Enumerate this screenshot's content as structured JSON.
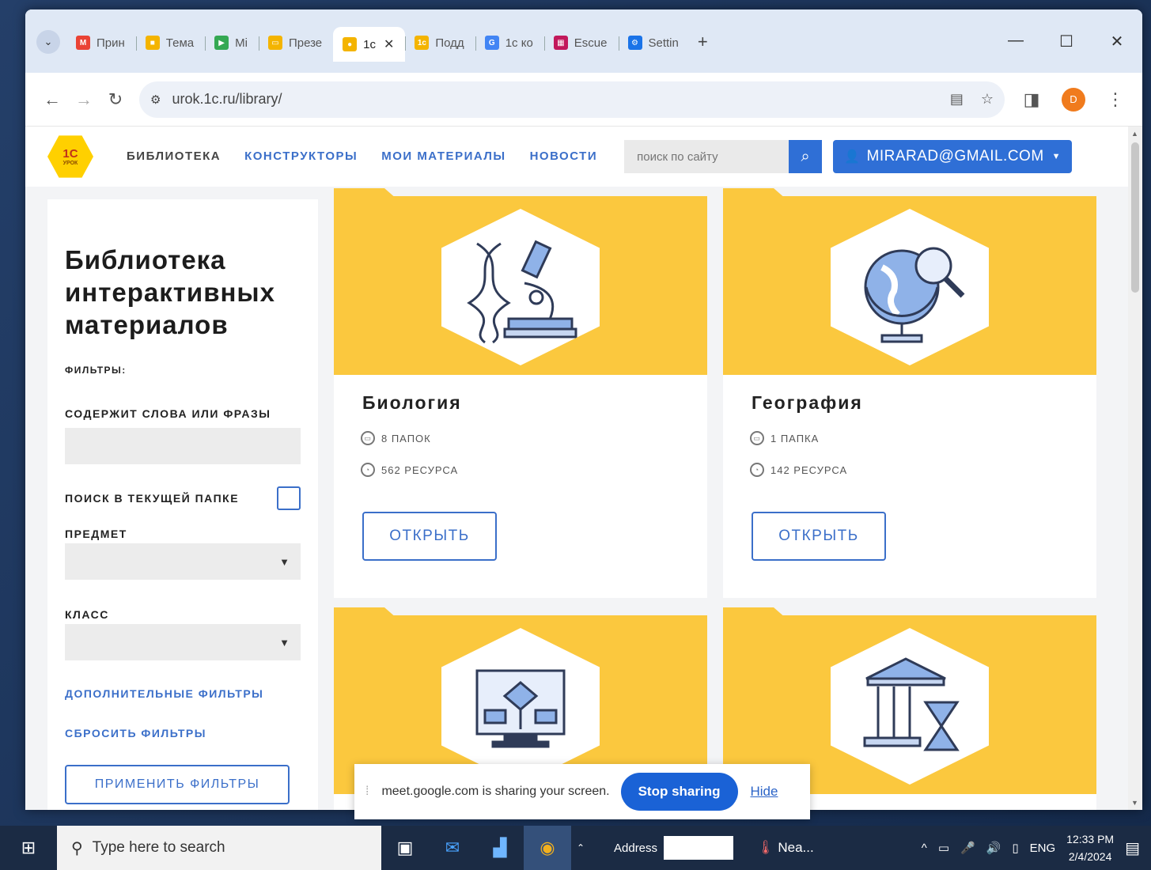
{
  "browser": {
    "tabs": [
      {
        "label": "Прин",
        "color": "#ea4335",
        "glyph": "M"
      },
      {
        "label": "Тема",
        "color": "#f4b400",
        "glyph": "■"
      },
      {
        "label": "Mi",
        "color": "#34a853",
        "glyph": "▶"
      },
      {
        "label": "Презе",
        "color": "#f4b400",
        "glyph": "▭"
      },
      {
        "label": "1с",
        "color": "#f4b400",
        "glyph": "●",
        "active": true
      },
      {
        "label": "Подд",
        "color": "#f4b400",
        "glyph": "1c"
      },
      {
        "label": "1с ко",
        "color": "#4285f4",
        "glyph": "G"
      },
      {
        "label": "Escue",
        "color": "#c2185b",
        "glyph": "▦"
      },
      {
        "label": "Settin",
        "color": "#1a73e8",
        "glyph": "⚙"
      }
    ],
    "new_tab": "+",
    "window_controls": {
      "minimize": "—",
      "maximize": "☐",
      "close": "✕"
    },
    "url": "urok.1c.ru/library/",
    "profile_initial": "D"
  },
  "site": {
    "logo_text": "1С",
    "logo_sub": "УРОК",
    "nav": [
      "БИБЛИОТЕКА",
      "КОНСТРУКТОРЫ",
      "МОИ МАТЕРИАЛЫ",
      "НОВОСТИ"
    ],
    "search_placeholder": "поиск по сайту",
    "user": "MIRARAD@GMAIL.COM"
  },
  "sidebar": {
    "title": "Библиотека интерактивных материалов",
    "filters_label": "ФИЛЬТРЫ:",
    "words_label": "СОДЕРЖИТ СЛОВА ИЛИ ФРАЗЫ",
    "current_folder_label": "ПОИСК В ТЕКУЩЕЙ ПАПКЕ",
    "subject_label": "ПРЕДМЕТ",
    "class_label": "КЛАСС",
    "more_filters": "ДОПОЛНИТЕЛЬНЫЕ ФИЛЬТРЫ",
    "reset_filters": "СБРОСИТЬ ФИЛЬТРЫ",
    "apply_filters": "ПРИМЕНИТЬ ФИЛЬТРЫ"
  },
  "cards": [
    {
      "title": "Биология",
      "folders": "8 ПАПОК",
      "resources": "562 РЕСУРСА",
      "open": "ОТКРЫТЬ"
    },
    {
      "title": "География",
      "folders": "1 ПАПКА",
      "resources": "142 РЕСУРСА",
      "open": "ОТКРЫТЬ"
    }
  ],
  "sharebar": {
    "message": "meet.google.com is sharing your screen.",
    "stop": "Stop sharing",
    "hide": "Hide"
  },
  "taskbar": {
    "search_placeholder": "Type here to search",
    "address_label": "Address",
    "weather": "Nea...",
    "language": "ENG",
    "time": "12:33 PM",
    "date": "2/4/2024"
  }
}
